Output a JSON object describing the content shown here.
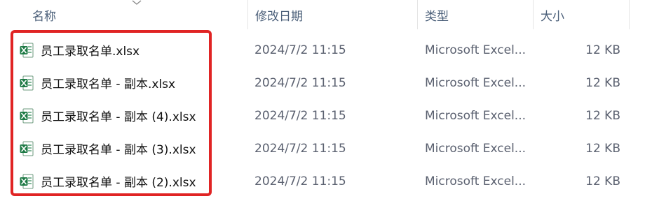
{
  "columns": {
    "name": "名称",
    "date": "修改日期",
    "type": "类型",
    "size": "大小"
  },
  "sort_icon": "chevron-down-icon",
  "file_icon": "excel-file-icon",
  "colors": {
    "excel_green": "#1d7a45",
    "highlight": "#e02424"
  },
  "files": [
    {
      "name": "员工录取名单.xlsx",
      "date": "2024/7/2 11:15",
      "type": "Microsoft Excel...",
      "size": "12 KB"
    },
    {
      "name": "员工录取名单 - 副本.xlsx",
      "date": "2024/7/2 11:15",
      "type": "Microsoft Excel...",
      "size": "12 KB"
    },
    {
      "name": "员工录取名单 - 副本 (4).xlsx",
      "date": "2024/7/2 11:15",
      "type": "Microsoft Excel...",
      "size": "12 KB"
    },
    {
      "name": "员工录取名单 - 副本 (3).xlsx",
      "date": "2024/7/2 11:15",
      "type": "Microsoft Excel...",
      "size": "12 KB"
    },
    {
      "name": "员工录取名单 - 副本 (2).xlsx",
      "date": "2024/7/2 11:15",
      "type": "Microsoft Excel...",
      "size": "12 KB"
    }
  ]
}
